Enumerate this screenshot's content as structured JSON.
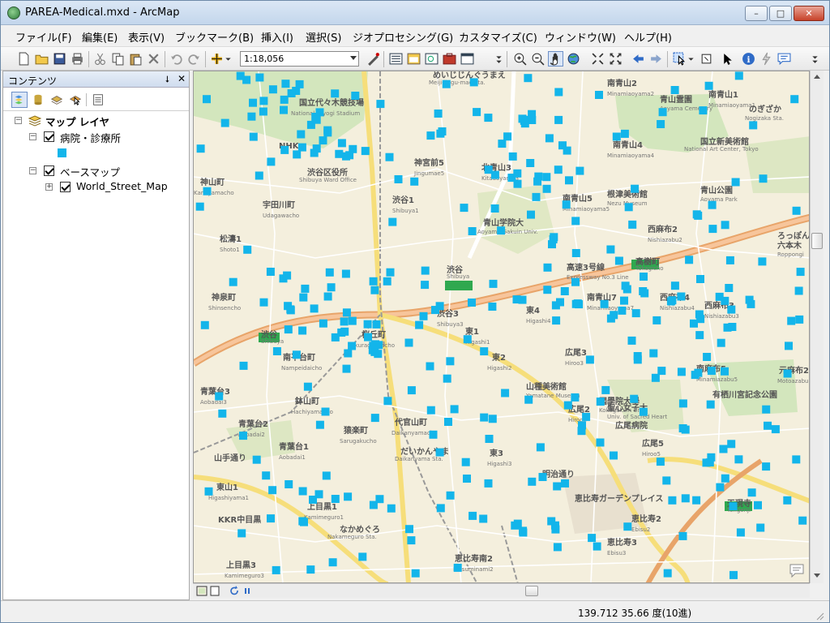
{
  "window": {
    "title": "PAREA-Medical.mxd - ArcMap",
    "minimize": "–",
    "maximize": "□",
    "close": "✕"
  },
  "menu": [
    {
      "label": "ファイル(F)"
    },
    {
      "label": "編集(E)"
    },
    {
      "label": "表示(V)"
    },
    {
      "label": "ブックマーク(B)"
    },
    {
      "label": "挿入(I)"
    },
    {
      "label": "選択(S)"
    },
    {
      "label": "ジオプロセシング(G)"
    },
    {
      "label": "カスタマイズ(C)"
    },
    {
      "label": "ウィンドウ(W)"
    },
    {
      "label": "ヘルプ(H)"
    }
  ],
  "toolbar": {
    "scale_value": "1:18,056"
  },
  "toc": {
    "title": "コンテンツ",
    "pin_icon": "⭣",
    "close_icon": "✕",
    "root": "マップ レイヤ",
    "layer_medical": "病院・診療所",
    "layer_basemap_group": "ベースマップ",
    "layer_world_street": "World_Street_Map"
  },
  "map": {
    "point_color": "#13b5ea",
    "labels": [
      {
        "t": "南青山2"
      },
      {
        "t": "Minamiaoyama2"
      },
      {
        "t": "南青山1"
      },
      {
        "t": "Minamiaoyama1"
      },
      {
        "t": "北青山3"
      },
      {
        "t": "Kitaaoyama3"
      },
      {
        "t": "南青山4"
      },
      {
        "t": "Minamiaoyama4"
      },
      {
        "t": "南青山5"
      },
      {
        "t": "Minamiaoyama5"
      },
      {
        "t": "神宮前5"
      },
      {
        "t": "Jingumae5"
      },
      {
        "t": "渋谷1"
      },
      {
        "t": "Shibuya1"
      },
      {
        "t": "宇田川町"
      },
      {
        "t": "Udagawacho"
      },
      {
        "t": "神山町"
      },
      {
        "t": "Kamiyamacho"
      },
      {
        "t": "松濤1"
      },
      {
        "t": "Shoto1"
      },
      {
        "t": "神泉町"
      },
      {
        "t": "Shinsencho"
      },
      {
        "t": "渋谷3"
      },
      {
        "t": "Shibuya3"
      },
      {
        "t": "桜丘町"
      },
      {
        "t": "Sakuragaokacho"
      },
      {
        "t": "東1"
      },
      {
        "t": "Higashi1"
      },
      {
        "t": "東2"
      },
      {
        "t": "Higashi2"
      },
      {
        "t": "東4"
      },
      {
        "t": "Higashi4"
      },
      {
        "t": "南平台町"
      },
      {
        "t": "Nampeidaicho"
      },
      {
        "t": "鉢山町"
      },
      {
        "t": "Hachiyamacho"
      },
      {
        "t": "青葉台3"
      },
      {
        "t": "Aobadai3"
      },
      {
        "t": "青葉台2"
      },
      {
        "t": "Aobadai2"
      },
      {
        "t": "青葉台1"
      },
      {
        "t": "Aobadai1"
      },
      {
        "t": "猿楽町"
      },
      {
        "t": "Sarugakucho"
      },
      {
        "t": "代官山町"
      },
      {
        "t": "Daikanyamacho"
      },
      {
        "t": "東山1"
      },
      {
        "t": "Higashiyama1"
      },
      {
        "t": "上目黒1"
      },
      {
        "t": "Kamimeguro1"
      },
      {
        "t": "上目黒3"
      },
      {
        "t": "Kamimeguro3"
      },
      {
        "t": "東3"
      },
      {
        "t": "Higashi3"
      },
      {
        "t": "広尾3"
      },
      {
        "t": "Hiroo3"
      },
      {
        "t": "広尾2"
      },
      {
        "t": "Hiroo2"
      },
      {
        "t": "広尾5"
      },
      {
        "t": "Hiroo5"
      },
      {
        "t": "南青山7"
      },
      {
        "t": "Minamiaoyama7"
      },
      {
        "t": "西麻布2"
      },
      {
        "t": "Nishiazabu2"
      },
      {
        "t": "西麻布4"
      },
      {
        "t": "Nishiazabu4"
      },
      {
        "t": "西麻布3"
      },
      {
        "t": "Nishiazabu3"
      },
      {
        "t": "南麻布5"
      },
      {
        "t": "Minamiazabu5"
      },
      {
        "t": "元麻布2"
      },
      {
        "t": "Motoazabu2"
      },
      {
        "t": "恵比寿2"
      },
      {
        "t": "Ebisu2"
      },
      {
        "t": "恵比寿3"
      },
      {
        "t": "Ebisu3"
      },
      {
        "t": "恵比寿南2"
      },
      {
        "t": "Ebisuminami2"
      },
      {
        "t": "渋谷"
      },
      {
        "t": "Shibuya"
      },
      {
        "t": "高樹町"
      },
      {
        "t": "Takagicho"
      },
      {
        "t": "天現寺"
      },
      {
        "t": "Tengenji"
      },
      {
        "t": "渋谷"
      },
      {
        "t": "Shibuya"
      },
      {
        "t": "高速3号線"
      },
      {
        "t": "Expressway No.3 Line"
      },
      {
        "t": "青山学院大"
      },
      {
        "t": "Aoyama Gakuin Univ."
      },
      {
        "t": "國學院大學"
      },
      {
        "t": "Kokugakuin Univ."
      },
      {
        "t": "聖心女子大"
      },
      {
        "t": "Univ. of Sacred Heart"
      },
      {
        "t": "NHK"
      },
      {
        "t": "渋谷区役所"
      },
      {
        "t": "Shibuya Ward Office"
      },
      {
        "t": "国立代々木競技場"
      },
      {
        "t": "National Yoyogi Stadium"
      },
      {
        "t": "青山公園"
      },
      {
        "t": "Aoyama Park"
      },
      {
        "t": "青山霊園"
      },
      {
        "t": "Aoyama Cemetery"
      },
      {
        "t": "国立新美術館"
      },
      {
        "t": "National Art Center, Tokyo"
      },
      {
        "t": "根津美術館"
      },
      {
        "t": "Nezu Museum"
      },
      {
        "t": "山種美術館"
      },
      {
        "t": "Yamatane Museum"
      },
      {
        "t": "有栖川宮記念公園"
      },
      {
        "t": "広尾病院"
      },
      {
        "t": "恵比寿ガーデンプレイス"
      },
      {
        "t": "KKR中目黒"
      },
      {
        "t": "なかめぐろ"
      },
      {
        "t": "Nakameguro Sta."
      },
      {
        "t": "だいかんやま"
      },
      {
        "t": "Daikanyama Sta."
      },
      {
        "t": "明治通り"
      },
      {
        "t": "山手通り"
      },
      {
        "t": "六本木"
      },
      {
        "t": "Roppongi"
      },
      {
        "t": "ろっぽんぎ"
      },
      {
        "t": "のぎざか"
      },
      {
        "t": "Nogizaka Sta."
      },
      {
        "t": "めいじじんぐうまえ"
      },
      {
        "t": "Meiji-jingu-mae Sta."
      }
    ]
  },
  "status": {
    "coords": "139.712  35.66 度(10進)"
  }
}
